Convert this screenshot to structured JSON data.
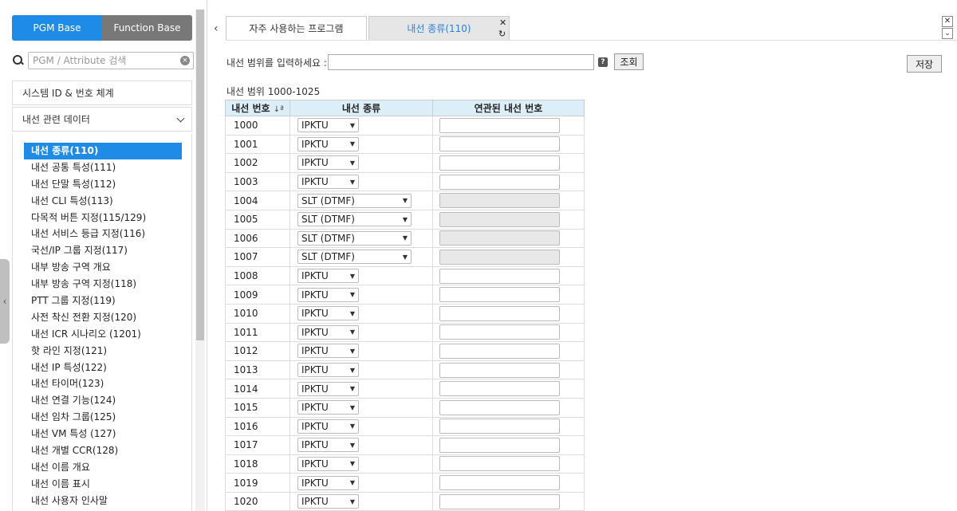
{
  "sidebar": {
    "base_buttons": {
      "pgm": "PGM Base",
      "function": "Function Base"
    },
    "search": {
      "placeholder": "PGM / Attribute 검색",
      "value": ""
    },
    "accordion": [
      {
        "label": "시스템 ID & 번호 체계"
      },
      {
        "label": "내선 관련 데이터"
      }
    ],
    "menu": [
      {
        "label": "내선 종류(110)",
        "selected": true
      },
      {
        "label": "내선 공통 특성(111)"
      },
      {
        "label": "내선 단말 특성(112)"
      },
      {
        "label": "내선 CLI 특성(113)"
      },
      {
        "label": "다목적 버튼 지정(115/129)"
      },
      {
        "label": "내선 서비스 등급 지정(116)"
      },
      {
        "label": "국선/IP 그룹 지정(117)"
      },
      {
        "label": "내부 방송 구역 개요"
      },
      {
        "label": "내부 방송 구역 지정(118)"
      },
      {
        "label": "PTT 그룹 지정(119)"
      },
      {
        "label": "사전 착신 전환 지정(120)"
      },
      {
        "label": "내선 ICR 시나리오 (1201)"
      },
      {
        "label": "핫 라인 지정(121)"
      },
      {
        "label": "내선 IP 특성(122)"
      },
      {
        "label": "내선 타이머(123)"
      },
      {
        "label": "내선 연결 기능(124)"
      },
      {
        "label": "내선 임차 그룹(125)"
      },
      {
        "label": "내선 VM 특성 (127)"
      },
      {
        "label": "내선 개별 CCR(128)"
      },
      {
        "label": "내선 이름 개요"
      },
      {
        "label": "내선 이름 표시"
      },
      {
        "label": "내선 사용자 인사말"
      }
    ]
  },
  "tabs": [
    {
      "label": "자주 사용하는 프로그램"
    },
    {
      "label": "내선 종류(110)"
    }
  ],
  "form": {
    "range_label": "내선 범위를 입력하세요 :",
    "range_value": "",
    "help": "?",
    "query_button": "조회",
    "save_button": "저장",
    "range_info": "내선 범위 1000-1025"
  },
  "table": {
    "headers": {
      "ext": "내선 번호",
      "sort_mark": "↓ª",
      "type": "내선 종류",
      "linked": "연관된 내선 번호"
    },
    "rows": [
      {
        "ext": "1000",
        "type": "IPKTU",
        "linked": "",
        "disabled": false
      },
      {
        "ext": "1001",
        "type": "IPKTU",
        "linked": "",
        "disabled": false
      },
      {
        "ext": "1002",
        "type": "IPKTU",
        "linked": "",
        "disabled": false
      },
      {
        "ext": "1003",
        "type": "IPKTU",
        "linked": "",
        "disabled": false
      },
      {
        "ext": "1004",
        "type": "SLT (DTMF)",
        "linked": "",
        "disabled": true
      },
      {
        "ext": "1005",
        "type": "SLT (DTMF)",
        "linked": "",
        "disabled": true
      },
      {
        "ext": "1006",
        "type": "SLT (DTMF)",
        "linked": "",
        "disabled": true
      },
      {
        "ext": "1007",
        "type": "SLT (DTMF)",
        "linked": "",
        "disabled": true
      },
      {
        "ext": "1008",
        "type": "IPKTU",
        "linked": "",
        "disabled": false
      },
      {
        "ext": "1009",
        "type": "IPKTU",
        "linked": "",
        "disabled": false
      },
      {
        "ext": "1010",
        "type": "IPKTU",
        "linked": "",
        "disabled": false
      },
      {
        "ext": "1011",
        "type": "IPKTU",
        "linked": "",
        "disabled": false
      },
      {
        "ext": "1012",
        "type": "IPKTU",
        "linked": "",
        "disabled": false
      },
      {
        "ext": "1013",
        "type": "IPKTU",
        "linked": "",
        "disabled": false
      },
      {
        "ext": "1014",
        "type": "IPKTU",
        "linked": "",
        "disabled": false
      },
      {
        "ext": "1015",
        "type": "IPKTU",
        "linked": "",
        "disabled": false
      },
      {
        "ext": "1016",
        "type": "IPKTU",
        "linked": "",
        "disabled": false
      },
      {
        "ext": "1017",
        "type": "IPKTU",
        "linked": "",
        "disabled": false
      },
      {
        "ext": "1018",
        "type": "IPKTU",
        "linked": "",
        "disabled": false
      },
      {
        "ext": "1019",
        "type": "IPKTU",
        "linked": "",
        "disabled": false
      },
      {
        "ext": "1020",
        "type": "IPKTU",
        "linked": "",
        "disabled": false
      }
    ]
  },
  "colors": {
    "accent": "#1e8be6",
    "inactive": "#787878",
    "header_bg": "#dceef8",
    "tab_active_text": "#2e7dd6"
  }
}
